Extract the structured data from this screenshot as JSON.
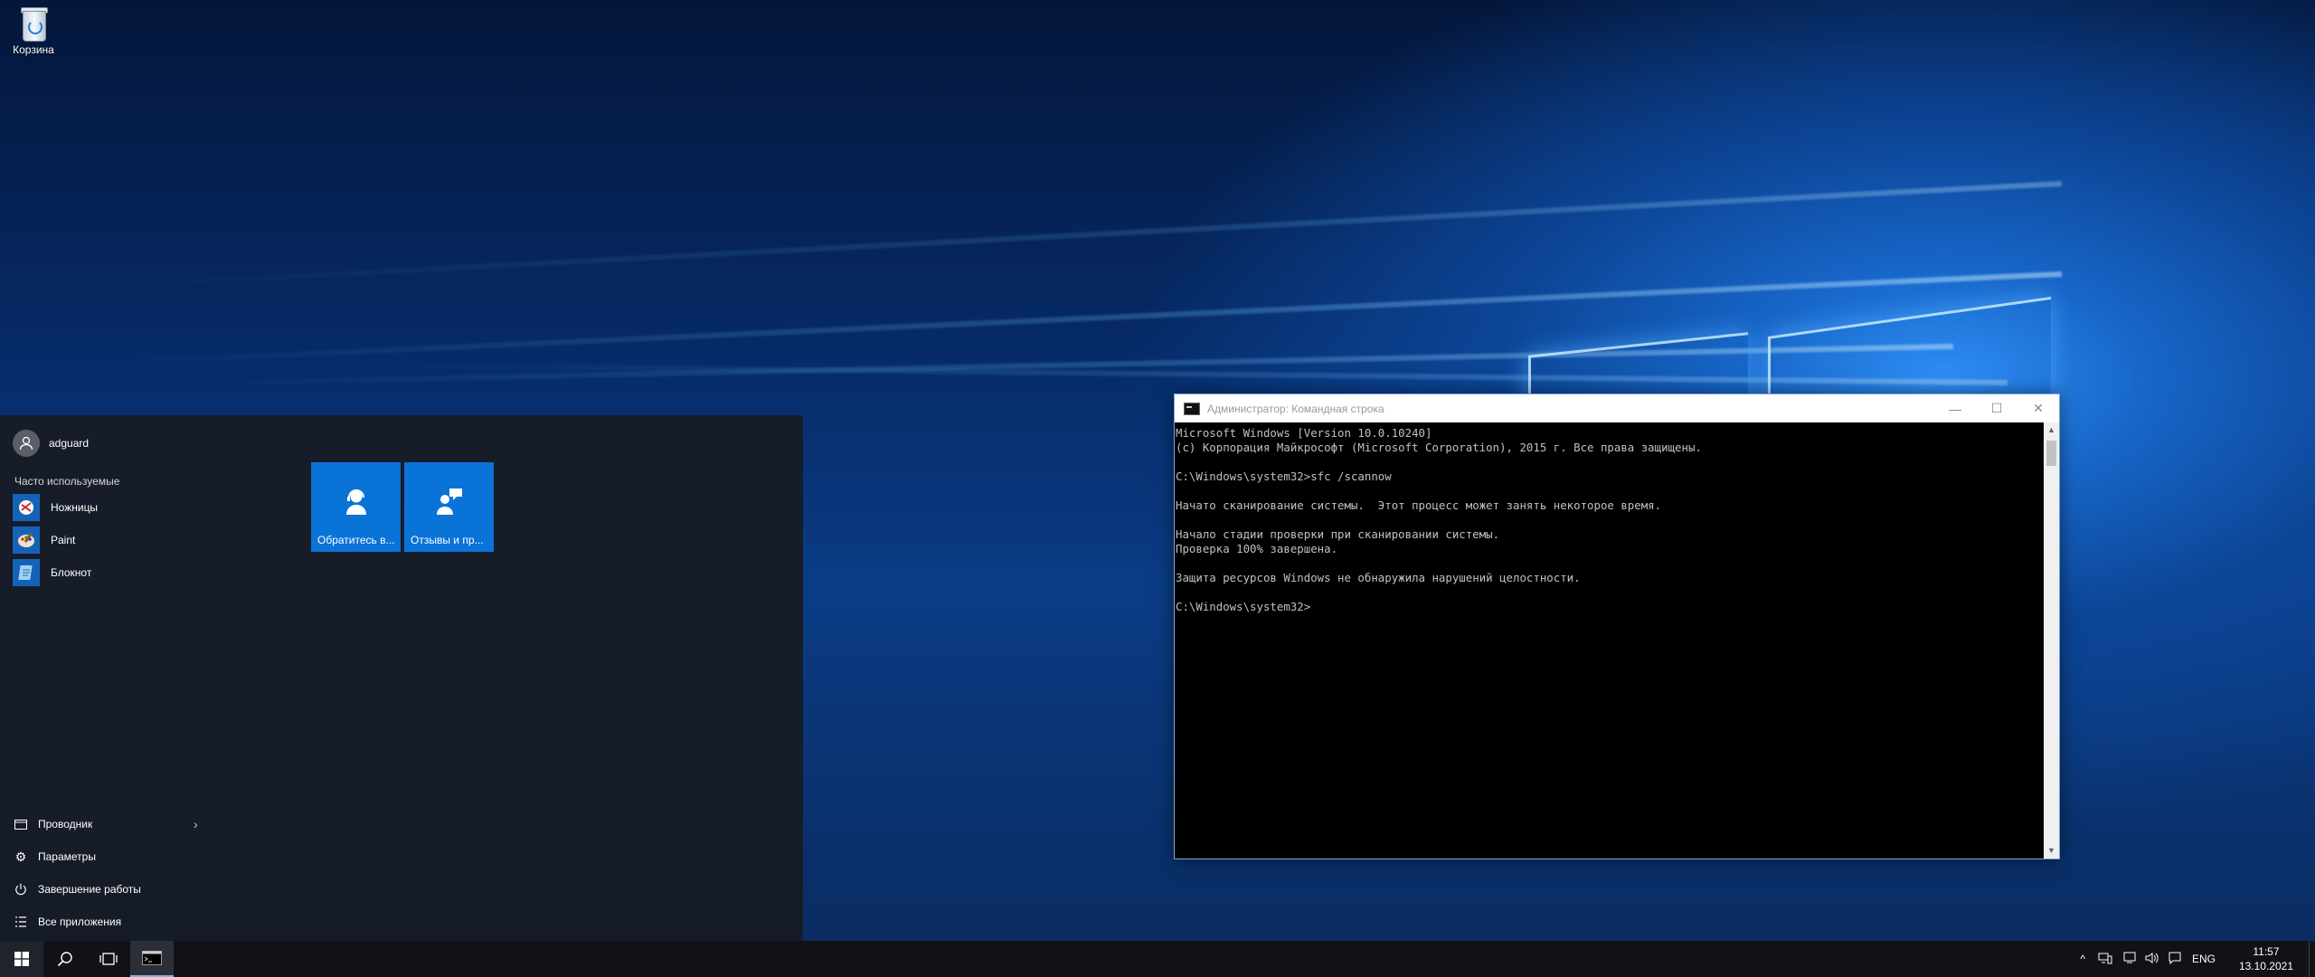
{
  "desktop": {
    "icons": [
      {
        "label": "Корзина",
        "icon": "recycle-bin-icon"
      }
    ]
  },
  "start_menu": {
    "user": {
      "name": "adguard",
      "icon": "user-avatar-icon"
    },
    "most_used_title": "Часто используемые",
    "most_used": [
      {
        "label": "Ножницы",
        "icon": "snipping-tool-icon"
      },
      {
        "label": "Paint",
        "icon": "paint-icon"
      },
      {
        "label": "Блокнот",
        "icon": "notepad-icon"
      }
    ],
    "bottom_items": [
      {
        "label": "Проводник",
        "icon": "file-explorer-icon",
        "has_arrow": true
      },
      {
        "label": "Параметры",
        "icon": "gear-icon"
      },
      {
        "label": "Завершение работы",
        "icon": "power-icon"
      },
      {
        "label": "Все приложения",
        "icon": "list-icon"
      }
    ],
    "tiles": [
      {
        "label": "Обратитесь в...",
        "icon": "contact-support-icon",
        "color": "#0a73d8"
      },
      {
        "label": "Отзывы и пр...",
        "icon": "feedback-icon",
        "color": "#0a73d8"
      }
    ]
  },
  "cmd_window": {
    "title": "Администратор: Командная строка",
    "lines": [
      "Microsoft Windows [Version 10.0.10240]",
      "(c) Корпорация Майкрософт (Microsoft Corporation), 2015 г. Все права защищены.",
      "",
      "C:\\Windows\\system32>sfc /scannow",
      "",
      "Начато сканирование системы.  Этот процесс может занять некоторое время.",
      "",
      "Начало стадии проверки при сканировании системы.",
      "Проверка 100% завершена.",
      "",
      "Защита ресурсов Windows не обнаружила нарушений целостности.",
      "",
      "C:\\Windows\\system32>"
    ],
    "buttons": {
      "minimize": "minimize-icon",
      "maximize": "maximize-icon",
      "close": "close-icon"
    }
  },
  "taskbar": {
    "items": [
      {
        "name": "start-button",
        "icon": "windows-logo-icon"
      },
      {
        "name": "search-button",
        "icon": "search-icon"
      },
      {
        "name": "task-view-button",
        "icon": "task-view-icon"
      },
      {
        "name": "cmd-taskbar-button",
        "icon": "command-prompt-icon",
        "active": true
      }
    ],
    "tray": {
      "language": "ENG",
      "time": "11:57",
      "date": "13.10.2021"
    }
  },
  "colors": {
    "accent": "#0a73d8",
    "taskbar": "#101218",
    "start_bg": "#181b22"
  }
}
